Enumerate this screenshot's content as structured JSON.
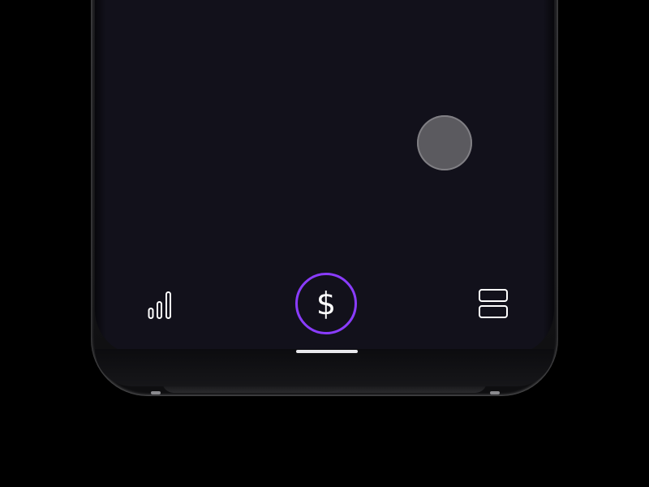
{
  "app": {
    "accent_color": "#8a3cff",
    "screen_background": "#12111b"
  },
  "floating_action": {
    "icon": "circle-button"
  },
  "bottom_nav": {
    "items": [
      {
        "id": "stats",
        "icon": "bar-chart-icon",
        "active": false
      },
      {
        "id": "money",
        "icon": "dollar-sign-icon",
        "glyph": "$",
        "active": true
      },
      {
        "id": "menu",
        "icon": "grid-menu-icon",
        "active": false
      }
    ]
  },
  "system": {
    "home_indicator": "home-indicator"
  }
}
